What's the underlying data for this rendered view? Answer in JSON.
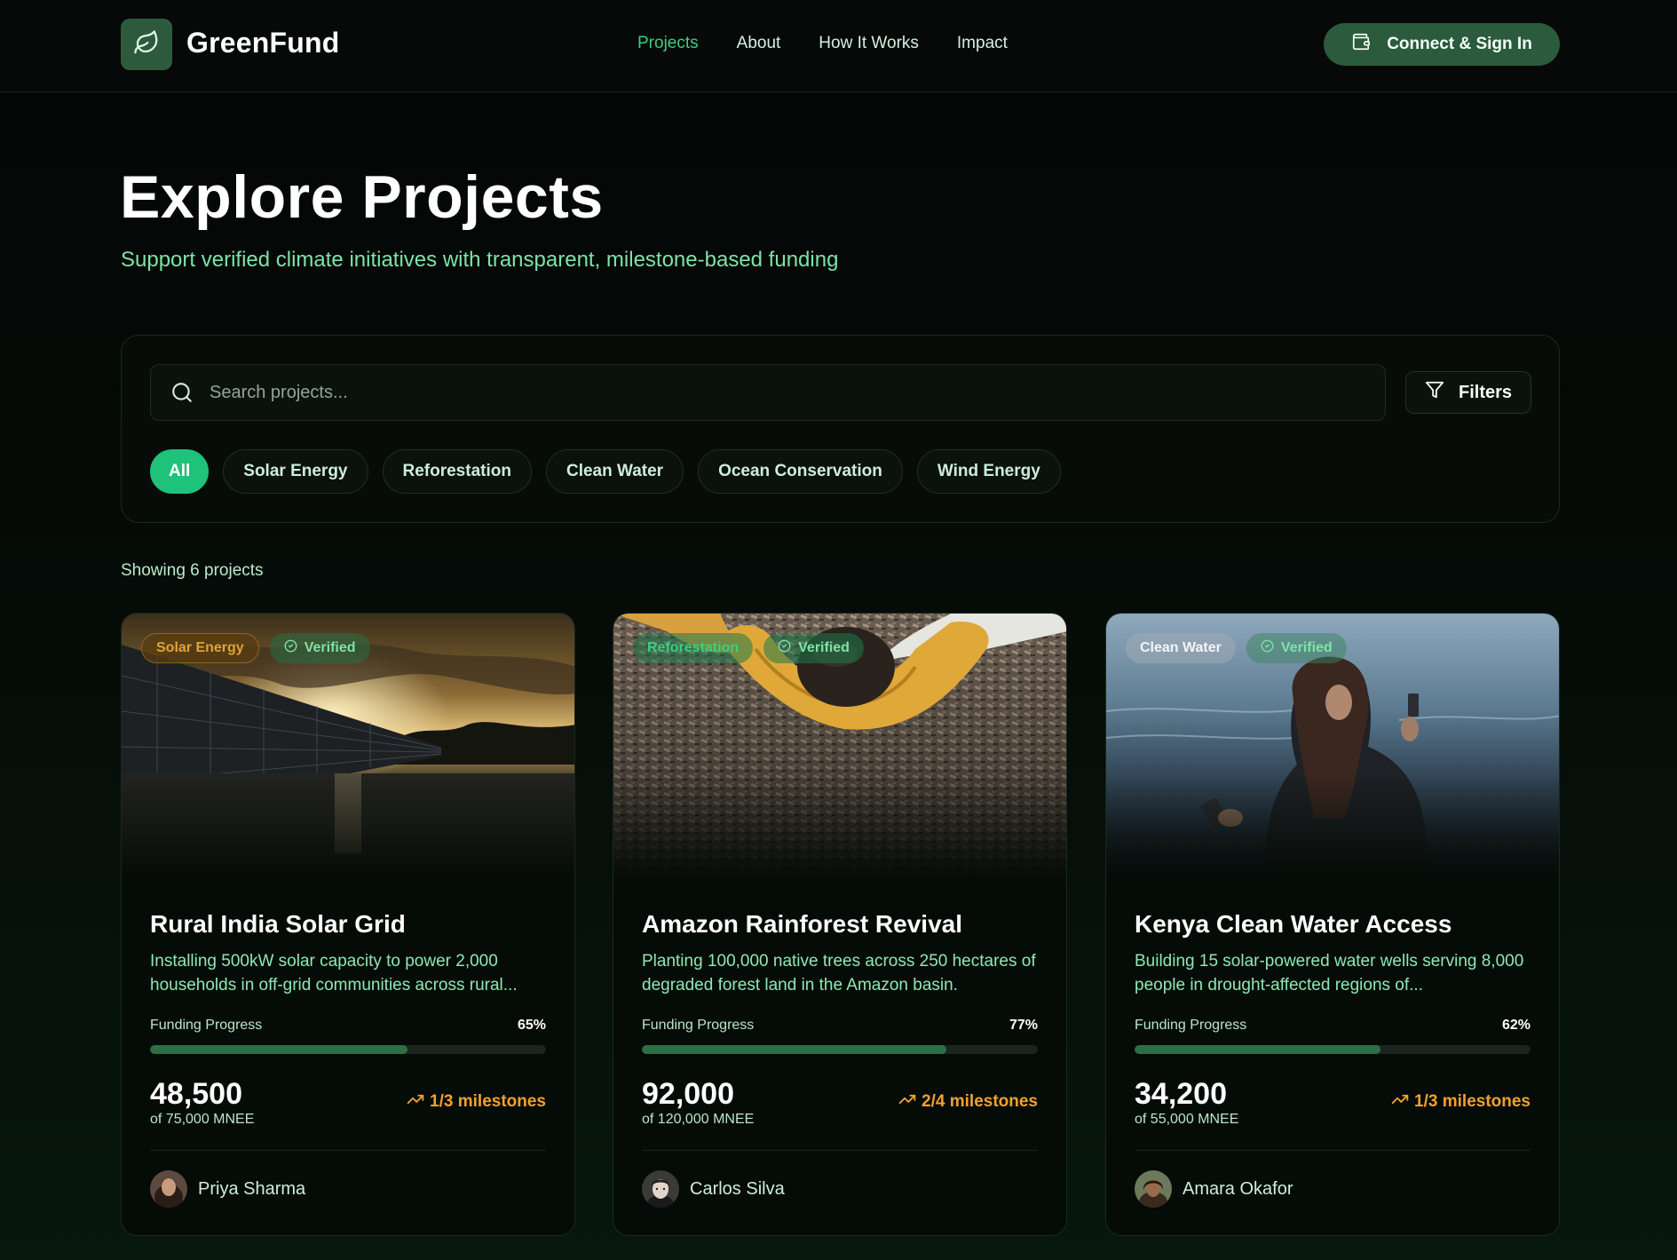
{
  "brand": {
    "name": "GreenFund",
    "accent": "#1ec27a",
    "logo_bg": "#2d5a3d"
  },
  "nav": {
    "items": [
      {
        "label": "Projects",
        "active": true
      },
      {
        "label": "About",
        "active": false
      },
      {
        "label": "How It Works",
        "active": false
      },
      {
        "label": "Impact",
        "active": false
      }
    ]
  },
  "header": {
    "connect_label": "Connect & Sign In"
  },
  "hero": {
    "title": "Explore Projects",
    "subtitle": "Support verified climate initiatives with transparent, milestone-based funding"
  },
  "search": {
    "placeholder": "Search projects...",
    "value": ""
  },
  "filters": {
    "label": "Filters"
  },
  "categories": [
    {
      "label": "All",
      "active": true
    },
    {
      "label": "Solar Energy",
      "active": false
    },
    {
      "label": "Reforestation",
      "active": false
    },
    {
      "label": "Clean Water",
      "active": false
    },
    {
      "label": "Ocean Conservation",
      "active": false
    },
    {
      "label": "Wind Energy",
      "active": false
    }
  ],
  "results": {
    "showing": "Showing 6 projects"
  },
  "progress_label": "Funding Progress",
  "projects": [
    {
      "category": "Solar Energy",
      "verified": "Verified",
      "title": "Rural India Solar Grid",
      "description": "Installing 500kW solar capacity to power 2,000 households in off-grid communities across rural...",
      "percent": "65%",
      "progress": 0.65,
      "raised": "48,500",
      "goal": "of 75,000 MNEE",
      "milestones": "1/3 milestones",
      "owner": "Priya Sharma",
      "badge_color": "#e0a23a"
    },
    {
      "category": "Reforestation",
      "verified": "Verified",
      "title": "Amazon Rainforest Revival",
      "description": "Planting 100,000 native trees across 250 hectares of degraded forest land in the Amazon basin.",
      "percent": "77%",
      "progress": 0.77,
      "raised": "92,000",
      "goal": "of 120,000 MNEE",
      "milestones": "2/4 milestones",
      "owner": "Carlos Silva",
      "badge_color": "#3ccf7f"
    },
    {
      "category": "Clean Water",
      "verified": "Verified",
      "title": "Kenya Clean Water Access",
      "description": "Building 15 solar-powered water wells serving 8,000 people in drought-affected regions of...",
      "percent": "62%",
      "progress": 0.62,
      "raised": "34,200",
      "goal": "of 55,000 MNEE",
      "milestones": "1/3 milestones",
      "owner": "Amara Okafor",
      "badge_color": "#dbe6f0"
    }
  ]
}
